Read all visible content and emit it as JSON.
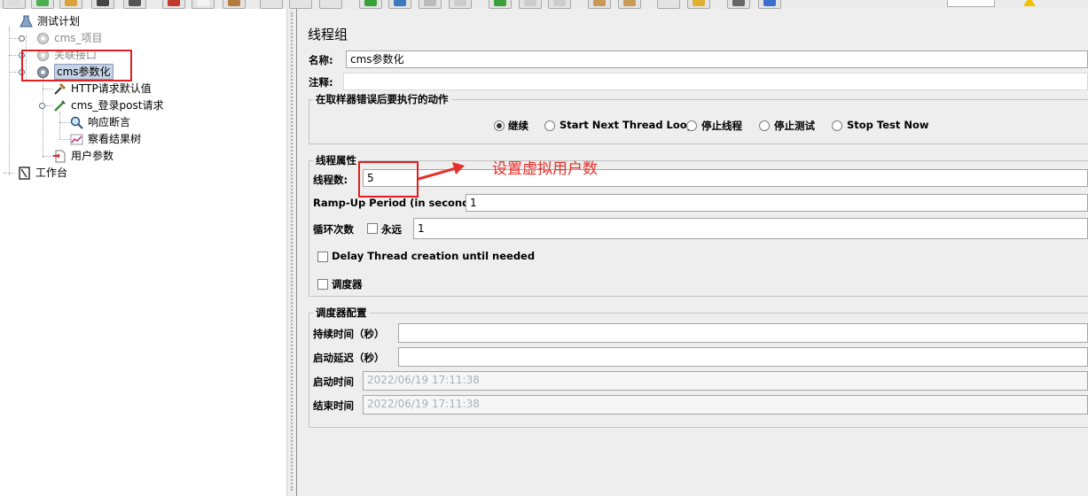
{
  "colors": {
    "annotation": "#e02020",
    "panel_bg": "#eeeeee",
    "selection": "#c6d3e6"
  },
  "tree": {
    "items": [
      {
        "label": "测试计划",
        "icon": "flask-icon"
      },
      {
        "label": "cms_项目",
        "icon": "gear-icon"
      },
      {
        "label": "关联接口",
        "icon": "gear-icon"
      },
      {
        "label": "cms参数化",
        "icon": "gear-icon"
      },
      {
        "label": "HTTP请求默认值",
        "icon": "wrench-icon"
      },
      {
        "label": "cms_登录post请求",
        "icon": "pipette-icon"
      },
      {
        "label": "响应断言",
        "icon": "magnifier-icon"
      },
      {
        "label": "察看结果树",
        "icon": "chart-icon"
      },
      {
        "label": "用户参数",
        "icon": "document-icon"
      },
      {
        "label": "工作台",
        "icon": "clipboard-icon"
      }
    ]
  },
  "panel": {
    "title": "线程组",
    "name_label": "名称:",
    "name_value": "cms参数化",
    "comment_label": "注释:",
    "comment_value": "",
    "error_action": {
      "title": "在取样器错误后要执行的动作",
      "options": [
        "继续",
        "Start Next Thread Loop",
        "停止线程",
        "停止测试",
        "Stop Test Now"
      ],
      "selected": "继续"
    },
    "thread_props": {
      "title": "线程属性",
      "threads_label": "线程数:",
      "threads_value": "5",
      "rampup_label": "Ramp-Up Period (in seconds):",
      "rampup_value": "1",
      "loop_label": "循环次数",
      "forever_label": "永远",
      "loop_value": "1",
      "delay_label": "Delay Thread creation until needed",
      "scheduler_label": "调度器"
    },
    "scheduler_config": {
      "title": "调度器配置",
      "duration_label": "持续时间（秒）",
      "duration_value": "",
      "delay_label": "启动延迟（秒）",
      "delay_value": "",
      "start_label": "启动时间",
      "start_value": "2022/06/19 17:11:38",
      "end_label": "结束时间",
      "end_value": "2022/06/19 17:11:38"
    }
  },
  "annotation": {
    "text": "设置虚拟用户数"
  }
}
